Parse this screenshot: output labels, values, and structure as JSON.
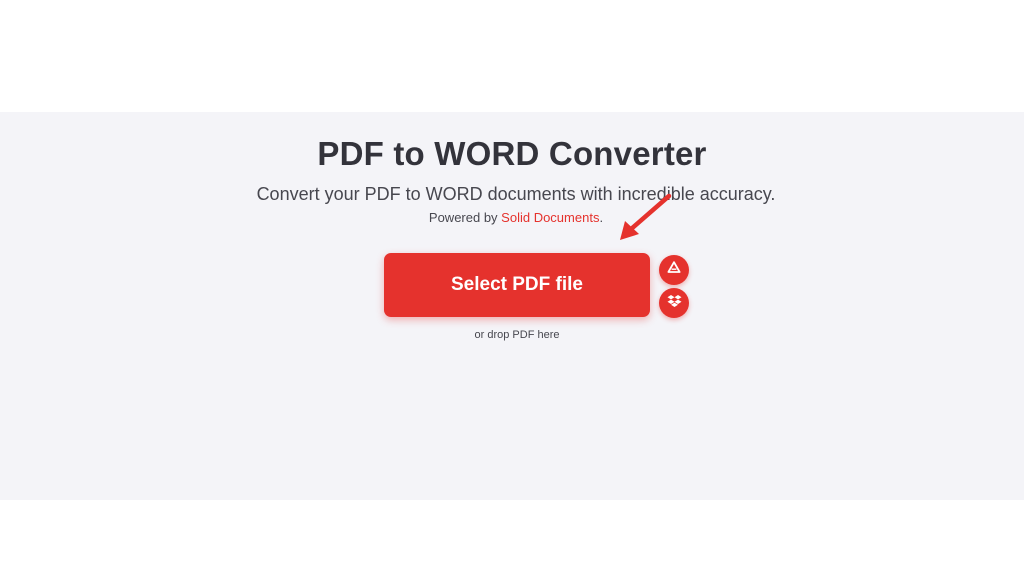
{
  "header": {
    "title": "PDF to WORD Converter",
    "subtitle": "Convert your PDF to WORD documents with incredible accuracy.",
    "powered_prefix": "Powered by ",
    "powered_link": "Solid Documents",
    "powered_suffix": "."
  },
  "uploader": {
    "select_label": "Select PDF file",
    "drop_hint": "or drop PDF here"
  },
  "icons": {
    "drive": "google-drive-icon",
    "dropbox": "dropbox-icon",
    "annotation_arrow": "red-arrow-icon"
  },
  "colors": {
    "accent": "#e5322d",
    "panel_background": "#f4f4f8",
    "title_text": "#33333b",
    "body_text": "#47474f"
  }
}
